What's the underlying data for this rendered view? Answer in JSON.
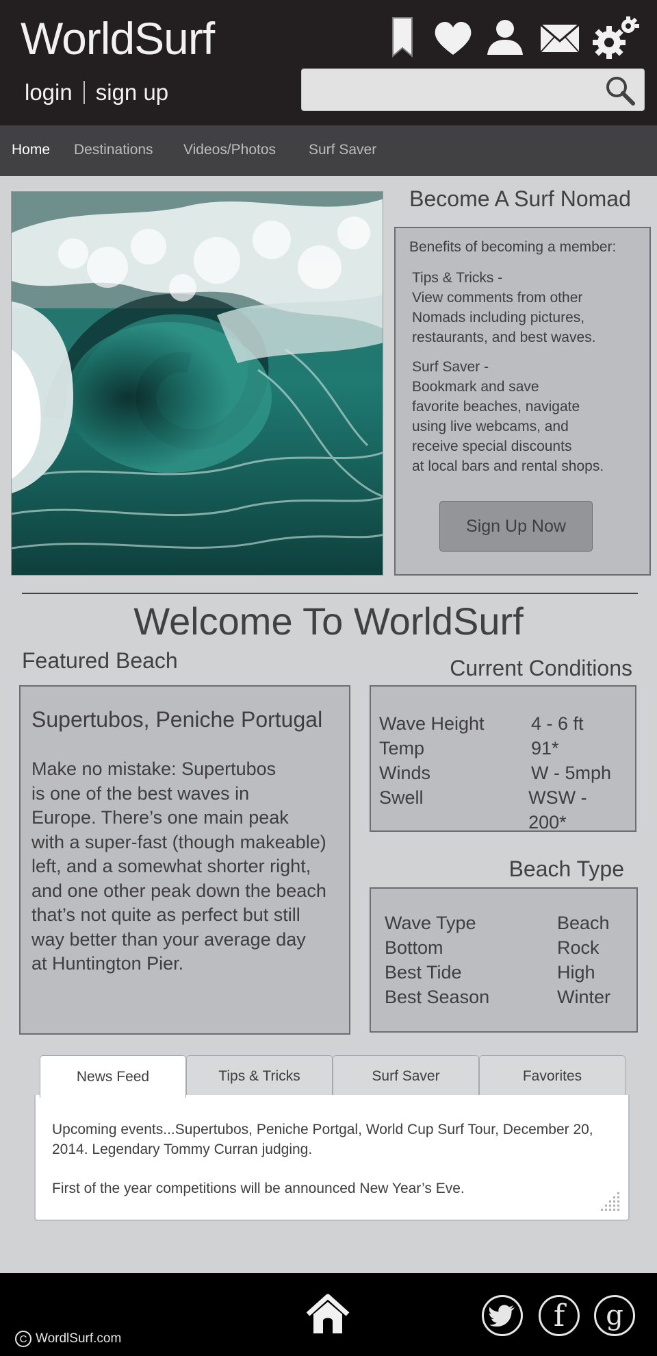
{
  "header": {
    "brand": "WorldSurf",
    "login_label": "login",
    "signup_label": "sign up",
    "icons": [
      "bookmark-icon",
      "heart-icon",
      "user-icon",
      "mail-icon",
      "settings-icon"
    ],
    "search": {
      "value": "",
      "placeholder": ""
    }
  },
  "nav": {
    "items": [
      {
        "label": "Home",
        "active": true
      },
      {
        "label": "Destinations"
      },
      {
        "label": "Videos/Photos"
      },
      {
        "label": "Surf Saver"
      }
    ]
  },
  "nomad": {
    "title": "Become A Surf Nomad",
    "intro": "Benefits of becoming a member:",
    "benefits": [
      {
        "lines": [
          "Tips & Tricks -",
          "View comments from other",
          "Nomads including pictures,",
          "restaurants, and best waves."
        ]
      },
      {
        "lines": [
          "Surf Saver -",
          "Bookmark and save",
          "favorite beaches, navigate",
          "using live webcams, and",
          "receive special discounts",
          "at local bars and rental shops."
        ]
      }
    ],
    "cta_label": "Sign Up Now"
  },
  "welcome_title": "Welcome To WorldSurf",
  "featured": {
    "title": "Featured Beach",
    "beach_name": "Supertubos, Peniche Portugal",
    "description_lines": [
      "Make no mistake: Supertubos",
      "is one of the best waves in",
      "Europe.  There’s one main peak",
      "with a super-fast (though makeable)",
      "left, and a somewhat shorter right,",
      "and one other peak down the beach",
      "that’s not quite as perfect but still",
      "way better than your average day",
      "at Huntington Pier."
    ]
  },
  "conditions": {
    "title": "Current Conditions",
    "rows": [
      {
        "key": "Wave Height",
        "value": "4 - 6 ft"
      },
      {
        "key": "Temp",
        "value": "91*"
      },
      {
        "key": "Winds",
        "value": "W - 5mph"
      },
      {
        "key": "Swell",
        "value": "WSW - 200*"
      }
    ]
  },
  "beach_type": {
    "title": "Beach Type",
    "rows": [
      {
        "key": "Wave Type",
        "value": "Beach"
      },
      {
        "key": "Bottom",
        "value": "Rock"
      },
      {
        "key": "Best Tide",
        "value": "High"
      },
      {
        "key": "Best Season",
        "value": "Winter"
      }
    ]
  },
  "tabs": {
    "items": [
      {
        "label": "News Feed",
        "active": true
      },
      {
        "label": "Tips & Tricks"
      },
      {
        "label": "Surf Saver"
      },
      {
        "label": "Favorites"
      }
    ],
    "feed_lines": [
      [
        "Upcoming events...Supertubos, Peniche Portgal, World Cup Surf Tour, December 20,",
        "2014.  Legendary Tommy Curran judging."
      ],
      [
        "First of the year competitions will be announced New Year’s Eve."
      ]
    ]
  },
  "footer": {
    "copyright_symbol": "C",
    "copyright": "WordlSurf.com",
    "icons": [
      "home-icon",
      "twitter-icon",
      "facebook-icon",
      "google-plus-icon"
    ],
    "facebook_glyph": "f",
    "google_glyph": "g"
  }
}
